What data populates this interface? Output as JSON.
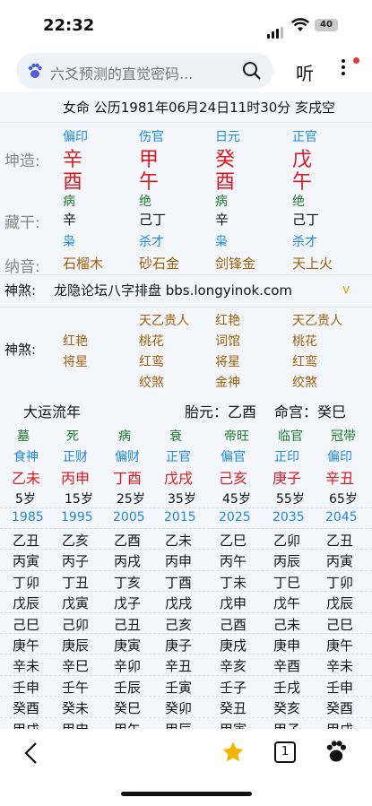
{
  "status": {
    "time": "22:32",
    "battery": "40"
  },
  "browser": {
    "search_text": "六爻预测的直觉密码...",
    "listen_label": "听"
  },
  "header": {
    "text": "女命 公历1981年06月24日11时30分 亥戌空"
  },
  "labels": {
    "kunzao": "坤造:",
    "canggan": "藏干:",
    "nayin": "纳音:",
    "shensha": "神煞:",
    "shensha2": "神煞:"
  },
  "pillars": [
    {
      "shishen": "偏印",
      "gan": "辛",
      "zhi": "酉",
      "state": "病",
      "canggan": "辛",
      "cg_shishen": "枭",
      "nayin": "石榴木"
    },
    {
      "shishen": "伤官",
      "gan": "甲",
      "zhi": "午",
      "state": "绝",
      "canggan": "己丁",
      "cg_shishen": "杀才",
      "nayin": "砂石金"
    },
    {
      "shishen": "日元",
      "gan": "癸",
      "zhi": "酉",
      "state": "病",
      "canggan": "辛",
      "cg_shishen": "枭",
      "nayin": "剑锋金"
    },
    {
      "shishen": "正官",
      "gan": "戊",
      "zhi": "午",
      "state": "绝",
      "canggan": "己丁",
      "cg_shishen": "杀才",
      "nayin": "天上火"
    }
  ],
  "forum": {
    "text": "龙隐论坛八字排盘 bbs.longyinok.com",
    "chevron": "v"
  },
  "shensha_cols": [
    [
      "红艳",
      "将星"
    ],
    [
      "天乙贵人",
      "桃花",
      "红鸾",
      "绞煞"
    ],
    [
      "红艳",
      "词馆",
      "将星",
      "金神"
    ],
    [
      "天乙贵人",
      "桃花",
      "红鸾",
      "绞煞"
    ]
  ],
  "dayun": {
    "title": "大运流年",
    "taiyuan": "胎元：乙酉",
    "minggong": "命宫：癸巳"
  },
  "yun_cols": [
    {
      "state": "墓",
      "shishen": "食神",
      "gz": "乙未",
      "age": "5岁",
      "year": "1985",
      "liunian": [
        "乙丑",
        "丙寅",
        "丁卯",
        "戊辰",
        "己巳",
        "庚午",
        "辛未",
        "壬申",
        "癸酉",
        "甲戌"
      ]
    },
    {
      "state": "死",
      "shishen": "正财",
      "gz": "丙申",
      "age": "15岁",
      "year": "1995",
      "liunian": [
        "乙亥",
        "丙子",
        "丁丑",
        "戊寅",
        "己卯",
        "庚辰",
        "辛巳",
        "壬午",
        "癸未",
        "甲申"
      ]
    },
    {
      "state": "病",
      "shishen": "偏财",
      "gz": "丁酉",
      "age": "25岁",
      "year": "2005",
      "liunian": [
        "乙酉",
        "丙戌",
        "丁亥",
        "戊子",
        "己丑",
        "庚寅",
        "辛卯",
        "壬辰",
        "癸巳",
        "甲午"
      ]
    },
    {
      "state": "衰",
      "shishen": "正官",
      "gz": "戊戌",
      "age": "35岁",
      "year": "2015",
      "liunian": [
        "乙未",
        "丙申",
        "丁酉",
        "戊戌",
        "己亥",
        "庚子",
        "辛丑",
        "壬寅",
        "癸卯",
        "甲辰"
      ]
    },
    {
      "state": "帝旺",
      "shishen": "偏官",
      "gz": "己亥",
      "age": "45岁",
      "year": "2025",
      "liunian": [
        "乙巳",
        "丙午",
        "丁未",
        "戊申",
        "己酉",
        "庚戌",
        "辛亥",
        "壬子",
        "癸丑",
        "甲寅"
      ]
    },
    {
      "state": "临官",
      "shishen": "正印",
      "gz": "庚子",
      "age": "55岁",
      "year": "2035",
      "liunian": [
        "乙卯",
        "丙辰",
        "丁巳",
        "戊午",
        "己未",
        "庚申",
        "辛酉",
        "壬戌",
        "癸亥",
        "甲子"
      ]
    },
    {
      "state": "冠带",
      "shishen": "偏印",
      "gz": "辛丑",
      "age": "65岁",
      "year": "2045",
      "liunian": [
        "乙丑",
        "丙寅",
        "丁卯",
        "戊辰",
        "己巳",
        "庚午",
        "辛未",
        "壬申",
        "癸酉",
        "甲戌"
      ]
    }
  ],
  "bottom": {
    "tab_count": "1"
  },
  "colors": {
    "blue": "#1e88e5",
    "red": "#d81b20",
    "green": "#1b7a2a",
    "brown": "#a0600a",
    "star": "#f5b400"
  }
}
